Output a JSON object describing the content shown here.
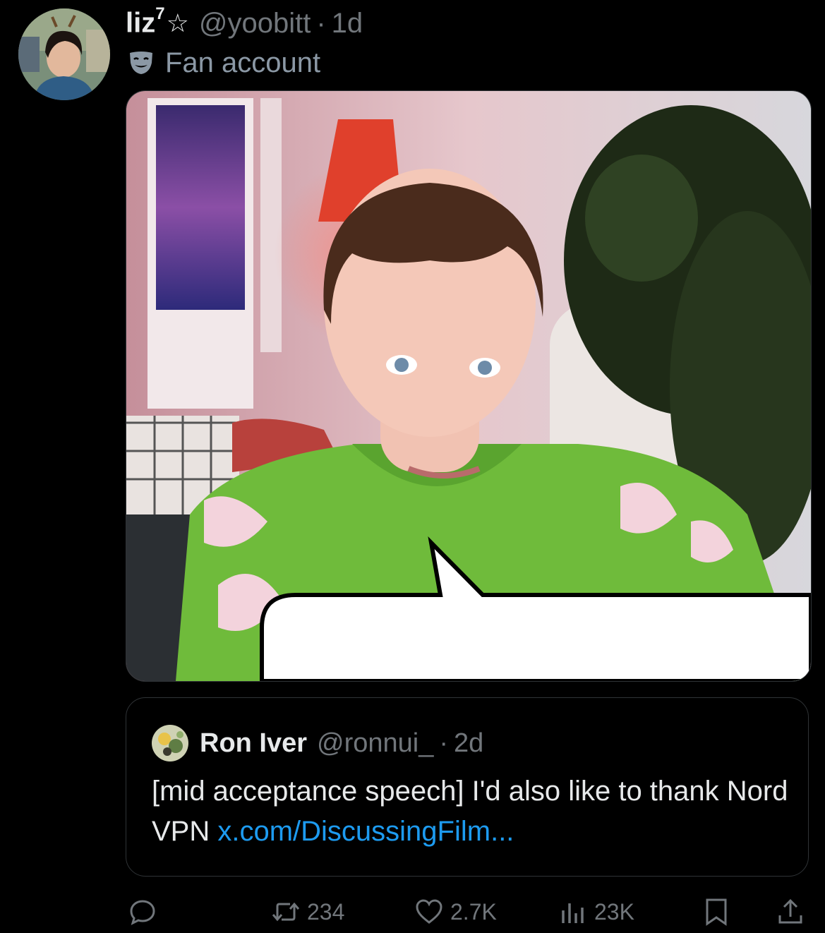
{
  "post": {
    "author": {
      "display_name": "liz",
      "superscript": "7",
      "badge": "☆",
      "handle": "@yoobitt",
      "separator": "·",
      "time": "1d",
      "label_icon": "theater-mask-icon",
      "label": "Fan account"
    },
    "media": {
      "icon": "photo-with-speech-bubble"
    },
    "quote": {
      "author_name": "Ron Iver",
      "handle": "@ronnui_",
      "separator": "·",
      "time": "2d",
      "text": "[mid acceptance speech] I'd also like to thank Nord VPN ",
      "link": "x.com/DiscussingFilm..."
    },
    "actions": {
      "replies_icon": "reply-icon",
      "reposts_icon": "repost-icon",
      "reposts": "234",
      "likes_icon": "heart-icon",
      "likes": "2.7K",
      "views_icon": "views-icon",
      "views": "23K",
      "bookmark_icon": "bookmark-icon",
      "share_icon": "share-icon"
    }
  },
  "colors": {
    "background": "#000000",
    "text": "#e7e9ea",
    "muted": "#71767b",
    "link": "#1d9bf0",
    "border": "#2f3336"
  }
}
